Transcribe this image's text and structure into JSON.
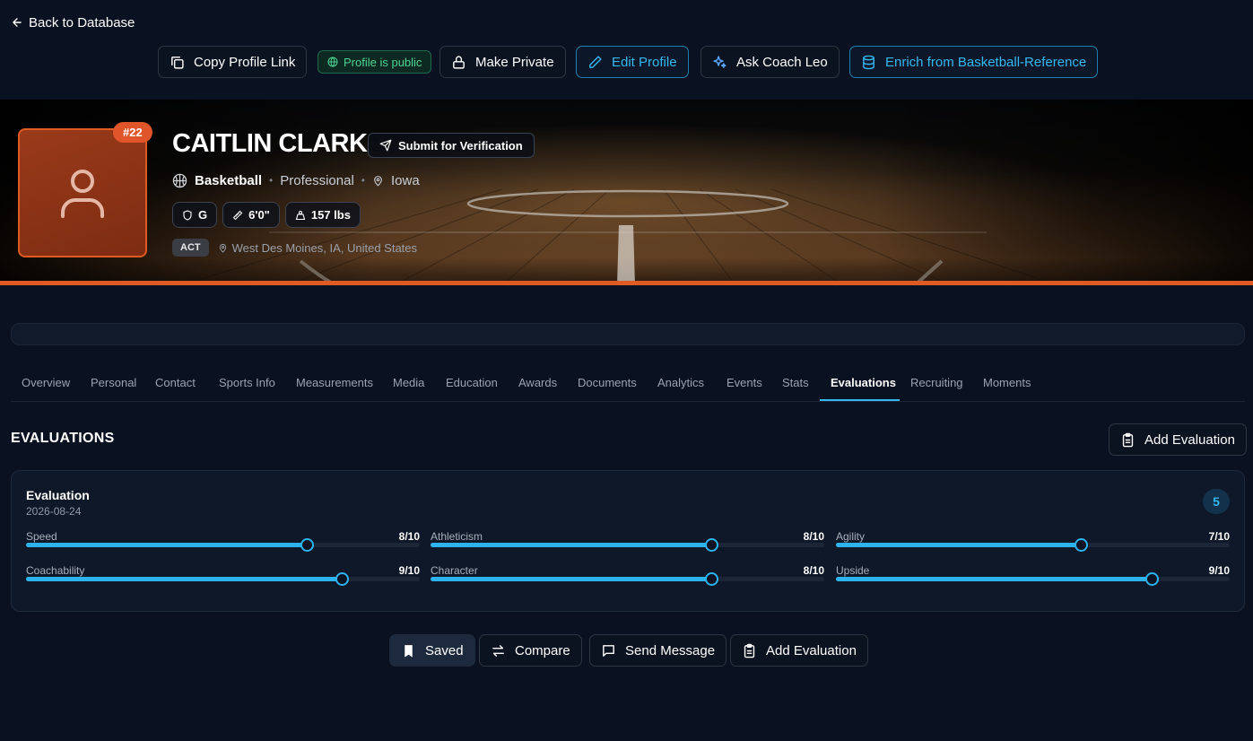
{
  "nav": {
    "back_label": "Back to Database"
  },
  "actions": {
    "copy_link": "Copy Profile Link",
    "public_status": "Profile is public",
    "make_private": "Make Private",
    "edit_profile": "Edit Profile",
    "ask_coach": "Ask Coach Leo",
    "enrich": "Enrich from Basketball-Reference"
  },
  "player": {
    "jersey": "#22",
    "name": "CAITLIN CLARK",
    "verify_label": "Submit for Verification",
    "sport": "Basketball",
    "level": "Professional",
    "location_short": "Iowa",
    "position": "G",
    "height": "6'0\"",
    "weight": "157 lbs",
    "test_badge": "ACT",
    "hometown": "West Des Moines, IA, United States"
  },
  "tabs": [
    "Overview",
    "Personal",
    "Contact",
    "Sports Info",
    "Measurements",
    "Media",
    "Education",
    "Awards",
    "Documents",
    "Analytics",
    "Events",
    "Stats",
    "Evaluations",
    "Recruiting",
    "Moments"
  ],
  "active_tab": "Evaluations",
  "section": {
    "title": "EVALUATIONS",
    "add_label": "Add Evaluation"
  },
  "evaluation": {
    "title": "Evaluation",
    "date": "2026-08-24",
    "score": "5",
    "metrics": [
      {
        "label": "Speed",
        "display": "8/10",
        "value": 8,
        "max": 10
      },
      {
        "label": "Athleticism",
        "display": "8/10",
        "value": 8,
        "max": 10
      },
      {
        "label": "Agility",
        "display": "7/10",
        "value": 7,
        "max": 10
      },
      {
        "label": "Coachability",
        "display": "9/10",
        "value": 9,
        "max": 10
      },
      {
        "label": "Character",
        "display": "8/10",
        "value": 8,
        "max": 10
      },
      {
        "label": "Upside",
        "display": "9/10",
        "value": 9,
        "max": 10
      }
    ]
  },
  "bottom_actions": {
    "saved": "Saved",
    "compare": "Compare",
    "message": "Send Message",
    "add_eval": "Add Evaluation"
  },
  "colors": {
    "accent_blue": "#35b7f0",
    "accent_orange": "#e05a23",
    "public_green": "#4ed494",
    "background": "#0a1120"
  }
}
